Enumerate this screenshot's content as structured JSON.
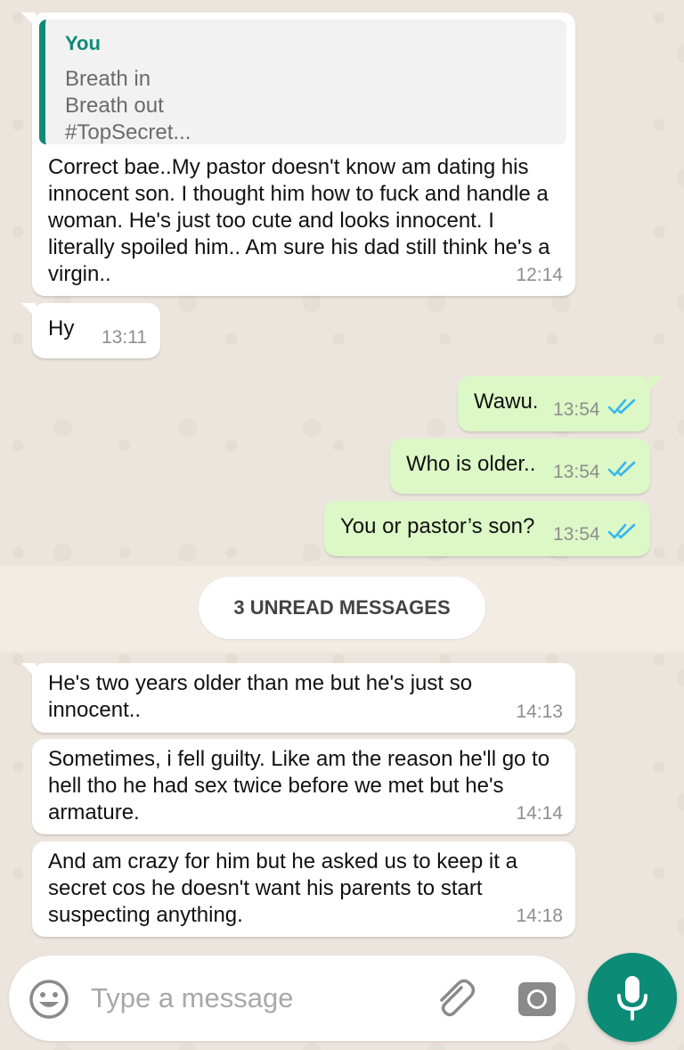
{
  "colors": {
    "incoming_bubble": "#ffffff",
    "outgoing_bubble": "#dcf8c6",
    "accent": "#0c8b76",
    "read_ticks": "#34b7f1"
  },
  "messages": [
    {
      "direction": "incoming",
      "quoted": {
        "author": "You",
        "lines": [
          "Breath in",
          "Breath out",
          "#TopSecret..."
        ]
      },
      "text": "Correct bae..My pastor doesn't know am dating his innocent son. I thought him how to fuck and handle a woman. He's just too cute and looks innocent. I literally spoiled him.. Am sure his dad still think he's a virgin..",
      "time": "12:14"
    },
    {
      "direction": "incoming",
      "text": "Hy",
      "time": "13:11"
    },
    {
      "direction": "outgoing",
      "text": "Wawu.",
      "time": "13:54",
      "status": "read"
    },
    {
      "direction": "outgoing",
      "text": "Who is older..",
      "time": "13:54",
      "status": "read"
    },
    {
      "direction": "outgoing",
      "text": "You or pastor’s son?",
      "time": "13:54",
      "status": "read"
    },
    {
      "direction": "incoming",
      "text": "He's two years older than me but he's just so innocent..",
      "time": "14:13"
    },
    {
      "direction": "incoming",
      "text": "Sometimes, i fell guilty. Like am the reason he'll go to hell tho he had sex twice before we met but he's armature.",
      "time": "14:14"
    },
    {
      "direction": "incoming",
      "text": "And am crazy for him but he asked us to keep it a secret cos he doesn't want his parents to start suspecting anything.",
      "time": "14:18"
    }
  ],
  "unread_divider": "3 UNREAD MESSAGES",
  "composer": {
    "placeholder": "Type a message",
    "emoji_icon": "emoji-icon",
    "attach_icon": "paperclip-icon",
    "camera_icon": "camera-icon",
    "mic_icon": "microphone-icon"
  }
}
